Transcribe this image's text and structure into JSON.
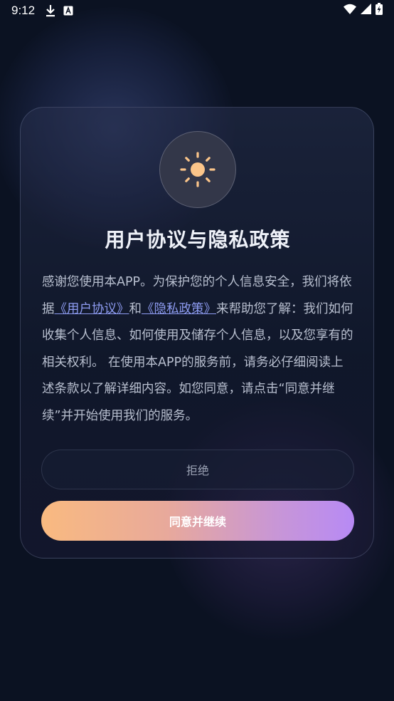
{
  "status_bar": {
    "time": "9:12",
    "icons_left": [
      "download-icon",
      "keyboard-a-icon"
    ],
    "icons_right": [
      "wifi-icon",
      "signal-icon",
      "battery-charging-icon"
    ]
  },
  "dialog": {
    "icon": "sun-icon",
    "title": "用户协议与隐私政策",
    "body": {
      "seg1": "感谢您使用本APP。为保护您的个人信息安全，我们将依据",
      "link_user_agreement": "《用户协议》",
      "seg2": "和",
      "link_privacy_policy": "《隐私政策》",
      "seg3": "来帮助您了解：我们如何收集个人信息、如何使用及储存个人信息，以及您享有的相关权利。 在使用本APP的服务前，请务必仔细阅读上述条款以了解详细内容。如您同意，请点击“同意并继续”并开始使用我们的服务。"
    },
    "reject_label": "拒绝",
    "agree_label": "同意并继续"
  },
  "colors": {
    "background": "#0b1222",
    "link": "#8e9cf2",
    "sun": "#fbc58a",
    "agree_gradient_start": "#f9ba80",
    "agree_gradient_end": "#b78af5"
  }
}
